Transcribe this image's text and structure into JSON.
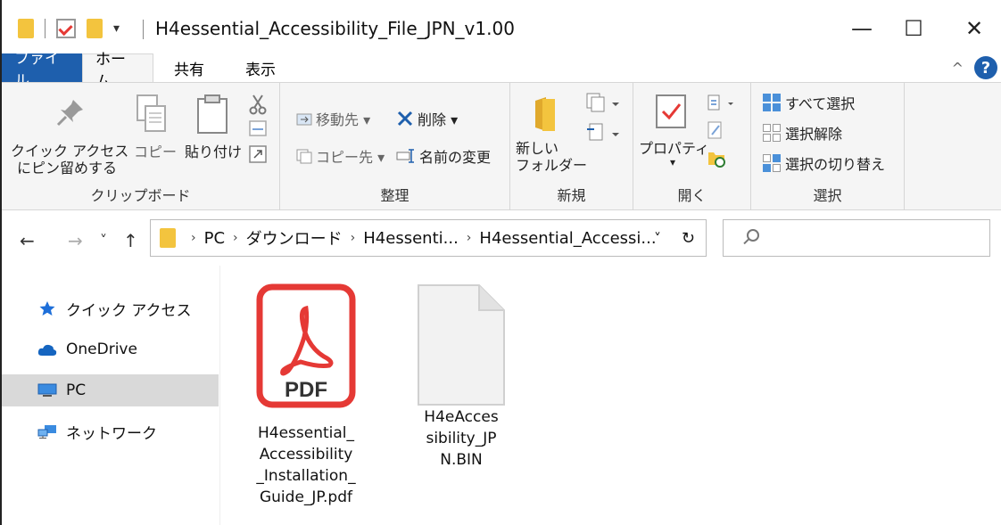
{
  "window": {
    "title": "H4essential_Accessibility_File_JPN_v1.00",
    "controls": {
      "minimize": "—",
      "maximize": "☐",
      "close": "✕"
    }
  },
  "qat": {
    "dropdown": "▾"
  },
  "tabs": [
    {
      "label": "ファイル"
    },
    {
      "label": "ホーム"
    },
    {
      "label": "共有"
    },
    {
      "label": "表示"
    }
  ],
  "ribbon": {
    "collapse": "^",
    "help": "?",
    "clipboard": {
      "pin_line1": "クイック アクセス",
      "pin_line2": "にピン留めする",
      "copy": "コピー",
      "paste": "貼り付け",
      "label": "クリップボード"
    },
    "organize": {
      "move_to": "移動先 ▾",
      "copy_to": "コピー先 ▾",
      "delete": "削除 ▾",
      "rename": "名前の変更",
      "label": "整理"
    },
    "new": {
      "new_folder_line1": "新しい",
      "new_folder_line2": "フォルダー",
      "label": "新規"
    },
    "open": {
      "properties": "プロパティ",
      "properties_arrow": "▾",
      "label": "開く"
    },
    "select": {
      "select_all": "すべて選択",
      "select_none": "選択解除",
      "invert": "選択の切り替え",
      "label": "選択"
    }
  },
  "navbar": {
    "back": "←",
    "forward": "→",
    "recent": "˅",
    "up": "↑",
    "crumbs": [
      "PC",
      "ダウンロード",
      "H4essenti...",
      "H4essential_Accessi..."
    ],
    "crumb_sep": "›",
    "dropdown": "˅",
    "refresh": "↻"
  },
  "navpane": [
    {
      "label": "クイック アクセス"
    },
    {
      "label": "OneDrive"
    },
    {
      "label": "PC"
    },
    {
      "label": "ネットワーク"
    }
  ],
  "files": [
    {
      "icon_text": "PDF",
      "name_lines": [
        "H4essential_",
        "Accessibility",
        "_Installation_",
        "Guide_JP.pdf"
      ]
    },
    {
      "name_lines": [
        "H4eAcces",
        "sibility_JP",
        "N.BIN"
      ]
    }
  ],
  "colors": {
    "accent": "#1e5fad",
    "folder": "#f3c43e",
    "pdf_red": "#e53935",
    "onedrive": "#1565c0"
  }
}
